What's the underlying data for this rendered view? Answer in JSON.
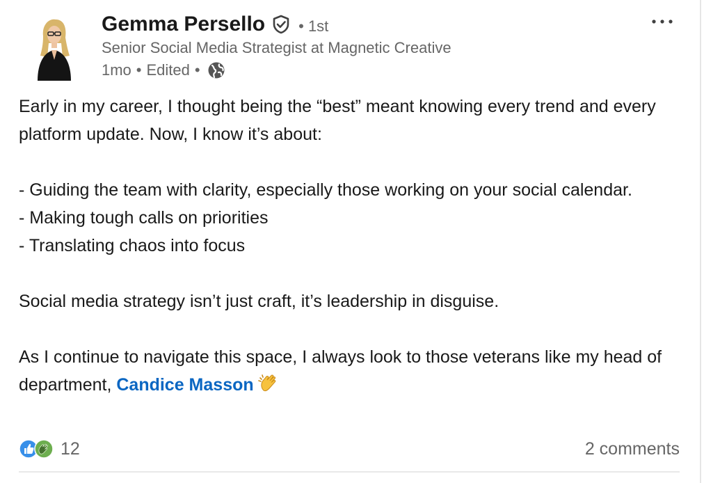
{
  "post": {
    "actor": {
      "name": "Gemma Persello",
      "degree": "• 1st",
      "headline": "Senior Social Media Strategist at Magnetic Creative",
      "time": "1mo",
      "edited": "Edited",
      "separator": "•",
      "verified_icon": "verified-shield-icon",
      "visibility_icon": "globe-icon"
    },
    "menu_icon": "more-options-icon",
    "body": {
      "line1": "Early in my career, I thought being the “best” meant knowing every trend and every platform update. Now, I know it’s about:",
      "bullet1": "- Guiding the team with clarity, especially those working on your social calendar.",
      "bullet2": "- Making tough calls on priorities",
      "bullet3": "- Translating chaos into focus",
      "paragraph2": "Social media strategy isn’t just craft, it’s leadership in disguise.",
      "paragraph3_prefix": "As I continue to navigate this space, I always look to those veterans like my head of department, ",
      "mention": "Candice Masson",
      "emoji": "👏"
    },
    "social": {
      "reaction_icons": [
        "like-reaction-icon",
        "celebrate-reaction-icon"
      ],
      "reaction_count": "12",
      "comments": "2 comments"
    },
    "colors": {
      "text": "#191919",
      "secondary": "#666666",
      "link": "#0a66c2",
      "like_blue": "#378fe9",
      "celebrate_green": "#44712e"
    }
  }
}
